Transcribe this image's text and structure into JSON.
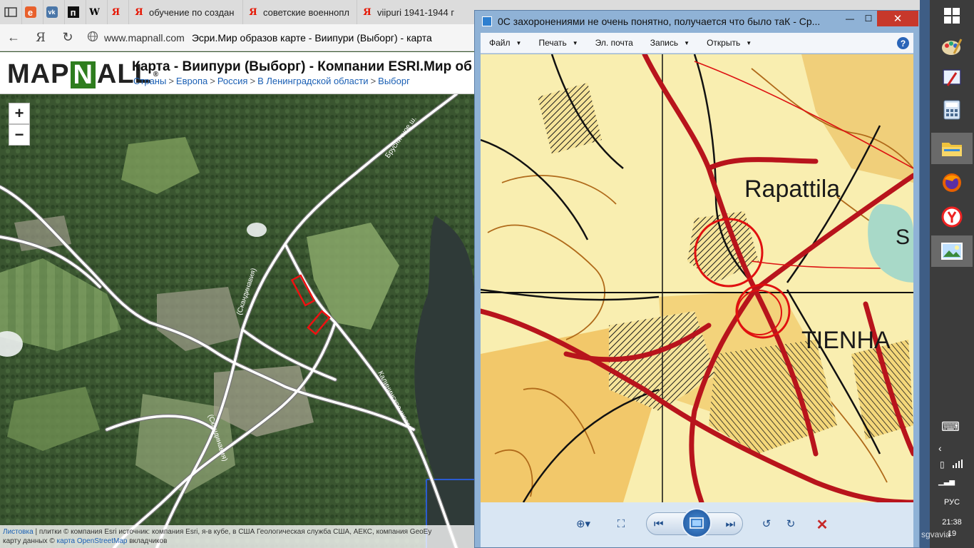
{
  "browser": {
    "tabs": [
      {
        "icon": "sidebar-icon",
        "label": ""
      },
      {
        "icon": "e-icon",
        "label": ""
      },
      {
        "icon": "vk-icon",
        "label": ""
      },
      {
        "icon": "p-icon",
        "label": ""
      },
      {
        "icon": "wikipedia-icon",
        "label": ""
      },
      {
        "icon": "yandex-icon",
        "label": ""
      },
      {
        "icon": "yandex-icon",
        "label": "обучение по создан"
      },
      {
        "icon": "yandex-icon",
        "label": "советские военнопл"
      },
      {
        "icon": "yandex-icon",
        "label": "viipuri 1941-1944 г"
      }
    ],
    "letters": {
      "e": "e",
      "vk": "vk",
      "p": "п",
      "w": "W",
      "ya": "Я"
    },
    "address": {
      "back_glyph": "←",
      "ya_glyph": "Я",
      "reload_glyph": "↻",
      "domain": "www.mapnall.com",
      "title": "Эсри.Мир образов карте - Виипури (Выборг) - карта"
    }
  },
  "site": {
    "logo": {
      "part1": "MAP",
      "part2": "N",
      "part3": "ALL",
      "mark": "®"
    },
    "title": "Карта - Виипури (Выборг) - Компании ESRI.Мир об",
    "breadcrumb": [
      "Страны",
      "Европа",
      "Россия",
      "В Ленинградской области",
      "Выборг"
    ],
    "breadcrumb_sep": ">"
  },
  "map": {
    "zoom_in": "+",
    "zoom_out": "−",
    "labels": {
      "road1": "(Скандинавия)",
      "road2": "(Скандинавия)",
      "road3": "Калининское шоссе",
      "road4": "Брусничное ш."
    },
    "attribution": {
      "link1": "Листовка",
      "text1": "| плитки © компания Esri источник: компания Esri, я-в кубе, в США Геологическая служба США, АЕКС, компания GeoEy",
      "text2": "карту данных ©",
      "link2": "карта",
      "link3": "OpenStreetMap",
      "text3": "вкладчиков"
    }
  },
  "viewer": {
    "title": "0С захоронениями не очень понятно, получается что было таК - Ср...",
    "controls": {
      "minimize": "—",
      "maximize": "☐",
      "close": "✕"
    },
    "menu": [
      {
        "label": "Файл",
        "arrow": "▼"
      },
      {
        "label": "Печать",
        "arrow": "▼"
      },
      {
        "label": "Эл. почта",
        "arrow": ""
      },
      {
        "label": "Запись",
        "arrow": "▼"
      },
      {
        "label": "Открыть",
        "arrow": "▼"
      }
    ],
    "help": "?",
    "map_labels": {
      "place1": "Rapattila",
      "place2": "TIENHA",
      "place3": "S"
    },
    "toolbar": {
      "zoom": "⊕▾",
      "fit": "⛶",
      "prev": "⏮",
      "next": "⏭",
      "rotate_left": "↺",
      "rotate_right": "↻",
      "delete": "✕"
    }
  },
  "taskbar": {
    "apps": [
      "windows-start-icon",
      "paint-icon",
      "snipping-icon",
      "calculator-icon",
      "file-explorer-icon",
      "firefox-icon",
      "yandex-browser-icon",
      "photo-viewer-icon"
    ],
    "tray": {
      "keyboard": "⌨",
      "chevron": "‹",
      "battery": "▯",
      "signal": "▁▃▅",
      "lang": "РУС",
      "time": "21:38",
      "date": "19"
    }
  },
  "watermark": "sgvavia",
  "colors": {
    "mapnall_green": "#2e7d1e",
    "link_blue": "#1a5fb4",
    "old_map_red": "#b8141c",
    "close_red": "#c7382b",
    "viewer_frame": "#8fb2d6"
  }
}
